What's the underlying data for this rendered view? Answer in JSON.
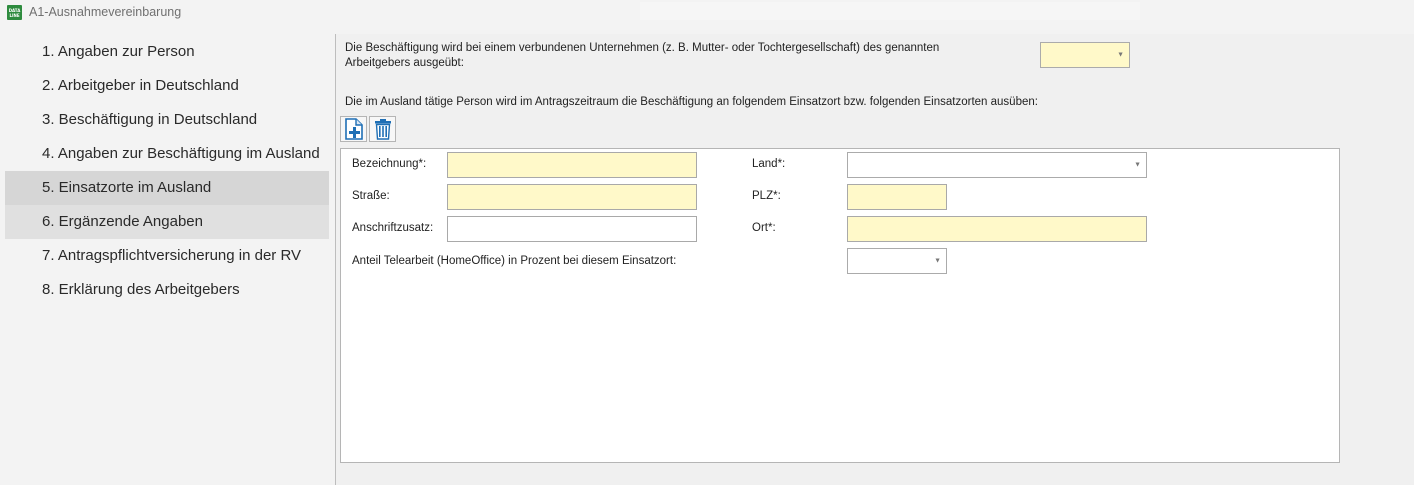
{
  "window": {
    "title": "A1-Ausnahmevereinbarung",
    "icon_lines": [
      "DATA",
      "LINE"
    ]
  },
  "sidebar": {
    "items": [
      {
        "label": "1. Angaben zur Person",
        "state": "normal"
      },
      {
        "label": "2. Arbeitgeber in Deutschland",
        "state": "normal"
      },
      {
        "label": "3. Beschäftigung in Deutschland",
        "state": "normal"
      },
      {
        "label": "4. Angaben zur Beschäftigung im Ausland",
        "state": "normal"
      },
      {
        "label": "5. Einsatzorte im Ausland",
        "state": "active"
      },
      {
        "label": "6. Ergänzende Angaben",
        "state": "hover"
      },
      {
        "label": "7. Antragspflichtversicherung in der RV",
        "state": "normal"
      },
      {
        "label": "8. Erklärung des Arbeitgebers",
        "state": "normal"
      }
    ]
  },
  "main": {
    "question_affiliated": "Die Beschäftigung wird bei einem verbundenen Unternehmen (z. B. Mutter- oder Tochtergesellschaft) des genannten Arbeitgebers ausgeübt:",
    "affiliated_value": "",
    "question_locations": "Die im Ausland tätige Person wird im Antragszeitraum die Beschäftigung an folgendem Einsatzort bzw. folgenden Einsatzorten ausüben:",
    "toolbar": {
      "add_icon": "add-document-icon",
      "delete_icon": "trash-icon"
    },
    "form": {
      "bezeichnung_label": "Bezeichnung*:",
      "bezeichnung_value": "",
      "strasse_label": "Straße:",
      "strasse_value": "",
      "anschriftzusatz_label": "Anschriftzusatz:",
      "anschriftzusatz_value": "",
      "land_label": "Land*:",
      "land_value": "",
      "plz_label": "PLZ*:",
      "plz_value": "",
      "ort_label": "Ort*:",
      "ort_value": "",
      "telearbeit_label": "Anteil Telearbeit (HomeOffice) in Prozent bei diesem Einsatzort:",
      "telearbeit_value": ""
    }
  },
  "colors": {
    "required_field": "#fff9c9",
    "active_nav": "#d6d6d6",
    "icon_blue": "#1f6fb5"
  }
}
